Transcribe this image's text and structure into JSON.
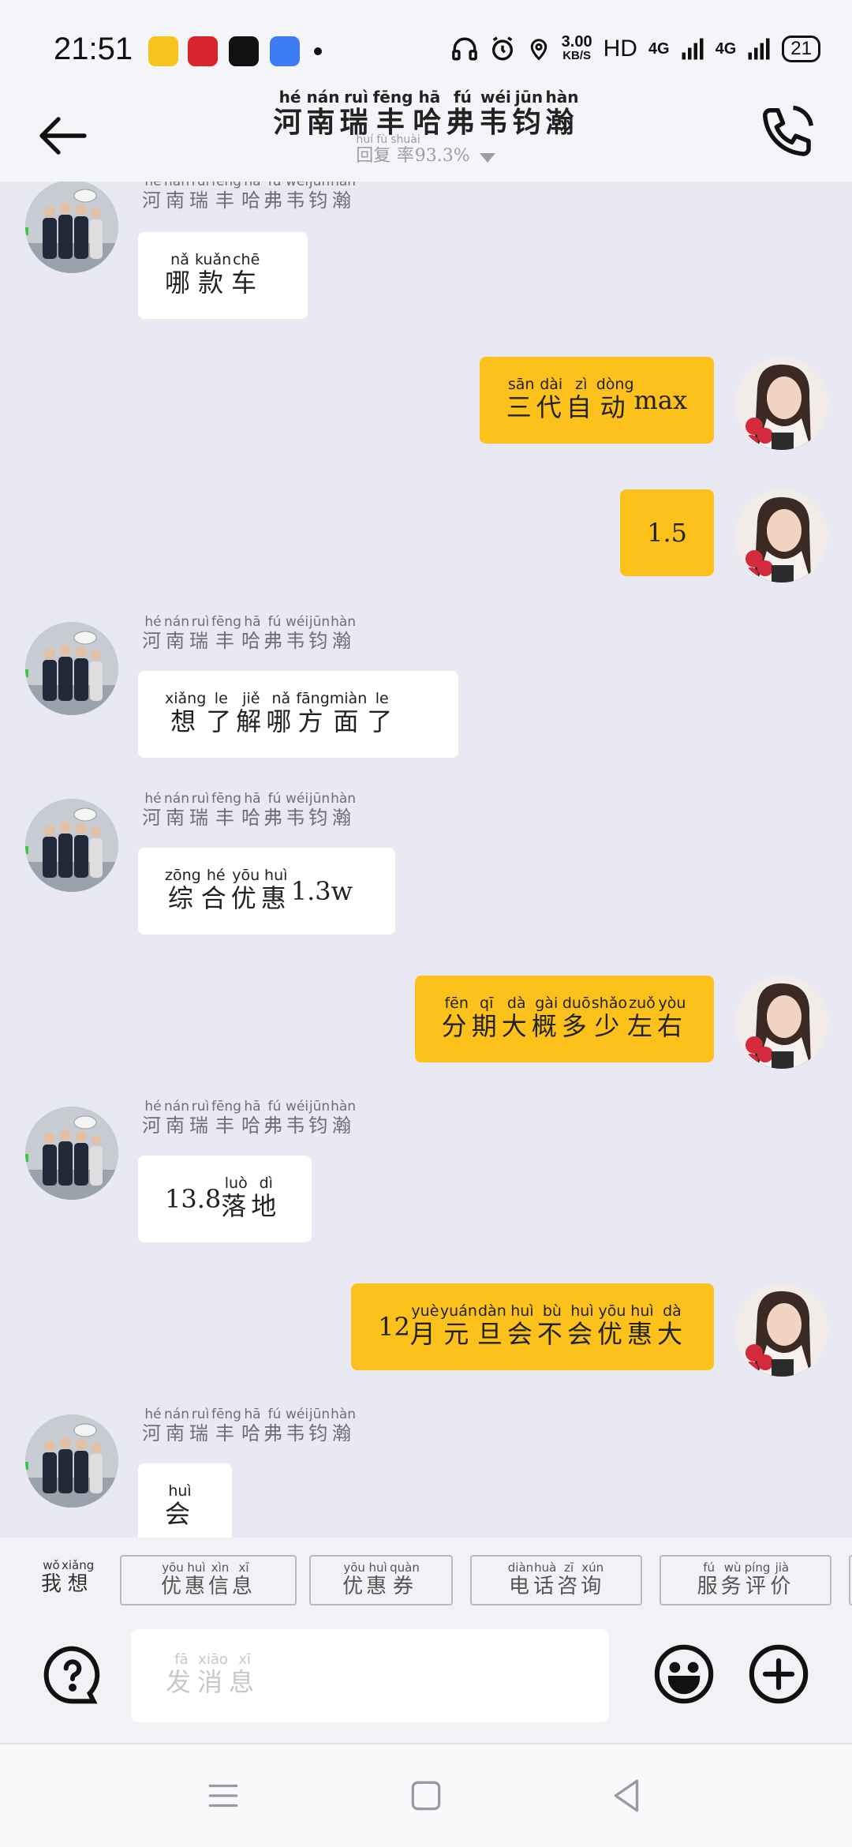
{
  "status_bar": {
    "time": "21:51",
    "net_speed": "3.00",
    "net_unit": "KB/S",
    "hd": "HD",
    "sig1": "4G",
    "sig2": "4G",
    "battery": "21",
    "icons": [
      "headphones-icon",
      "alarm-icon",
      "location-icon"
    ]
  },
  "header": {
    "title": [
      {
        "c": "河",
        "p": "hé"
      },
      {
        "c": "南",
        "p": "nán"
      },
      {
        "c": "瑞",
        "p": "ruì"
      },
      {
        "c": "丰",
        "p": "fēng"
      },
      {
        "c": "哈",
        "p": "hā"
      },
      {
        "c": "弗",
        "p": "fú"
      },
      {
        "c": "韦",
        "p": "wéi"
      },
      {
        "c": "钧",
        "p": "jūn"
      },
      {
        "c": "瀚",
        "p": "hàn"
      }
    ],
    "reply_rate_label": [
      {
        "c": "回",
        "p": "huí"
      },
      {
        "c": "复",
        "p": "fù"
      },
      {
        "c": "率",
        "p": "shuài"
      }
    ],
    "reply_rate_value": "93.3%"
  },
  "agent_name": [
    {
      "c": "河",
      "p": "hé"
    },
    {
      "c": "南",
      "p": "nán"
    },
    {
      "c": "瑞",
      "p": "ruì"
    },
    {
      "c": "丰",
      "p": "fēng"
    },
    {
      "c": "哈",
      "p": "hā"
    },
    {
      "c": "弗",
      "p": "fú"
    },
    {
      "c": "韦",
      "p": "wéi"
    },
    {
      "c": "钧",
      "p": "jūn"
    },
    {
      "c": "瀚",
      "p": "hàn"
    }
  ],
  "messages": [
    {
      "from": "agent",
      "parts": [
        {
          "c": "哪",
          "p": "nǎ"
        },
        {
          "c": "款",
          "p": "kuǎn"
        },
        {
          "c": "车",
          "p": "chē"
        }
      ]
    },
    {
      "from": "user",
      "parts": [
        {
          "c": "三",
          "p": "sān"
        },
        {
          "c": "代",
          "p": "dài"
        },
        {
          "c": "自",
          "p": "zì"
        },
        {
          "c": "动",
          "p": "dòng"
        },
        {
          "t": "max"
        }
      ]
    },
    {
      "from": "user",
      "parts": [
        {
          "t": "1.5"
        }
      ]
    },
    {
      "from": "agent",
      "parts": [
        {
          "c": "想",
          "p": "xiǎng"
        },
        {
          "c": "了",
          "p": "le"
        },
        {
          "c": "解",
          "p": "jiě"
        },
        {
          "c": "哪",
          "p": "nǎ"
        },
        {
          "c": "方",
          "p": "fāng"
        },
        {
          "c": "面",
          "p": "miàn"
        },
        {
          "c": "了",
          "p": "le"
        }
      ]
    },
    {
      "from": "agent",
      "parts": [
        {
          "c": "综",
          "p": "zōng"
        },
        {
          "c": "合",
          "p": "hé"
        },
        {
          "c": "优",
          "p": "yōu"
        },
        {
          "c": "惠",
          "p": "huì"
        },
        {
          "t": "1.3w"
        }
      ]
    },
    {
      "from": "user",
      "parts": [
        {
          "c": "分",
          "p": "fēn"
        },
        {
          "c": "期",
          "p": "qī"
        },
        {
          "c": "大",
          "p": "dà"
        },
        {
          "c": "概",
          "p": "gài"
        },
        {
          "c": "多",
          "p": "duō"
        },
        {
          "c": "少",
          "p": "shǎo"
        },
        {
          "c": "左",
          "p": "zuǒ"
        },
        {
          "c": "右",
          "p": "yòu"
        }
      ]
    },
    {
      "from": "agent",
      "parts": [
        {
          "t": "13.8"
        },
        {
          "c": "落",
          "p": "luò"
        },
        {
          "c": "地",
          "p": "dì"
        }
      ]
    },
    {
      "from": "user",
      "parts": [
        {
          "t": "12"
        },
        {
          "c": "月",
          "p": "yuè"
        },
        {
          "c": "元",
          "p": "yuán"
        },
        {
          "c": "旦",
          "p": "dàn"
        },
        {
          "c": "会",
          "p": "huì"
        },
        {
          "c": "不",
          "p": "bù"
        },
        {
          "c": "会",
          "p": "huì"
        },
        {
          "c": "优",
          "p": "yōu"
        },
        {
          "c": "惠",
          "p": "huì"
        },
        {
          "c": "大",
          "p": "dà"
        }
      ]
    },
    {
      "from": "agent",
      "parts": [
        {
          "c": "会",
          "p": "huì"
        }
      ]
    }
  ],
  "quick_replies": {
    "lead": [
      {
        "c": "我",
        "p": "wǒ"
      },
      {
        "c": "想",
        "p": "xiǎng"
      }
    ],
    "chips": [
      [
        {
          "c": "优",
          "p": "yōu"
        },
        {
          "c": "惠",
          "p": "huì"
        },
        {
          "c": "信",
          "p": "xìn"
        },
        {
          "c": "息",
          "p": "xī"
        }
      ],
      [
        {
          "c": "优",
          "p": "yōu"
        },
        {
          "c": "惠",
          "p": "huì"
        },
        {
          "c": "券",
          "p": "quàn"
        }
      ],
      [
        {
          "c": "电",
          "p": "diàn"
        },
        {
          "c": "话",
          "p": "huà"
        },
        {
          "c": "咨",
          "p": "zī"
        },
        {
          "c": "询",
          "p": "xún"
        }
      ],
      [
        {
          "c": "服",
          "p": "fú"
        },
        {
          "c": "务",
          "p": "wù"
        },
        {
          "c": "评",
          "p": "píng"
        },
        {
          "c": "价",
          "p": "jià"
        }
      ]
    ]
  },
  "input": {
    "placeholder": [
      {
        "c": "发",
        "p": "fā"
      },
      {
        "c": "消",
        "p": "xiāo"
      },
      {
        "c": "息",
        "p": "xī"
      }
    ]
  },
  "colors": {
    "user_bubble": "#fcc21b",
    "agent_bubble": "#ffffff",
    "chat_background": "#e8e9f3"
  }
}
